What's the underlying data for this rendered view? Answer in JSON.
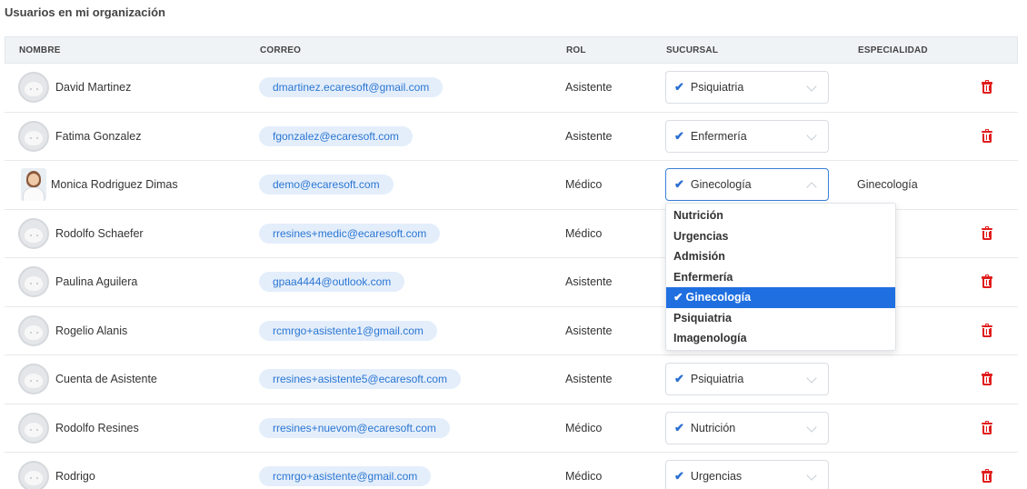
{
  "page": {
    "title": "Usuarios en mi organización"
  },
  "table": {
    "headers": {
      "name": "NOMBRE",
      "email": "CORREO",
      "role": "ROL",
      "branch": "SUCURSAL",
      "specialty": "ESPECIALIDAD"
    },
    "rows": [
      {
        "name": "David Martinez",
        "email": "dmartinez.ecaresoft@gmail.com",
        "role": "Asistente",
        "branch": "Psiquiatria",
        "specialty": ""
      },
      {
        "name": "Fatima Gonzalez",
        "email": "fgonzalez@ecaresoft.com",
        "role": "Asistente",
        "branch": "Enfermería",
        "specialty": ""
      },
      {
        "name": "Monica Rodriguez Dimas",
        "email": "demo@ecaresoft.com",
        "role": "Médico",
        "branch": "Ginecología",
        "specialty": "Ginecología"
      },
      {
        "name": "Rodolfo Schaefer",
        "email": "rresines+medic@ecaresoft.com",
        "role": "Médico",
        "branch": "",
        "specialty": ""
      },
      {
        "name": "Paulina Aguilera",
        "email": "gpaa4444@outlook.com",
        "role": "Asistente",
        "branch": "",
        "specialty": ""
      },
      {
        "name": "Rogelio Alanis",
        "email": "rcmrgo+asistente1@gmail.com",
        "role": "Asistente",
        "branch": "",
        "specialty": ""
      },
      {
        "name": "Cuenta de Asistente",
        "email": "rresines+asistente5@ecaresoft.com",
        "role": "Asistente",
        "branch": "Psiquiatria",
        "specialty": ""
      },
      {
        "name": "Rodolfo Resines",
        "email": "rresines+nuevom@ecaresoft.com",
        "role": "Médico",
        "branch": "Nutrición",
        "specialty": ""
      },
      {
        "name": "Rodrigo",
        "email": "rcmrgo+asistente@gmail.com",
        "role": "Médico",
        "branch": "Urgencias",
        "specialty": ""
      }
    ]
  },
  "dropdown": {
    "options": [
      "Nutrición",
      "Urgencias",
      "Admisión",
      "Enfermería",
      "Ginecología",
      "Psiquiatria",
      "Imagenología"
    ],
    "selected": "Ginecología"
  },
  "icons": {
    "check": "check-icon",
    "chevron": "chevron-icon",
    "delete": "trash-icon",
    "avatar": "default-avatar-icon"
  },
  "colors": {
    "accent": "#1f6fe0",
    "pill_bg": "#e4eefb",
    "pill_text": "#2a76d2",
    "delete": "#e01d1d",
    "header_bg": "#f0f3f6"
  }
}
